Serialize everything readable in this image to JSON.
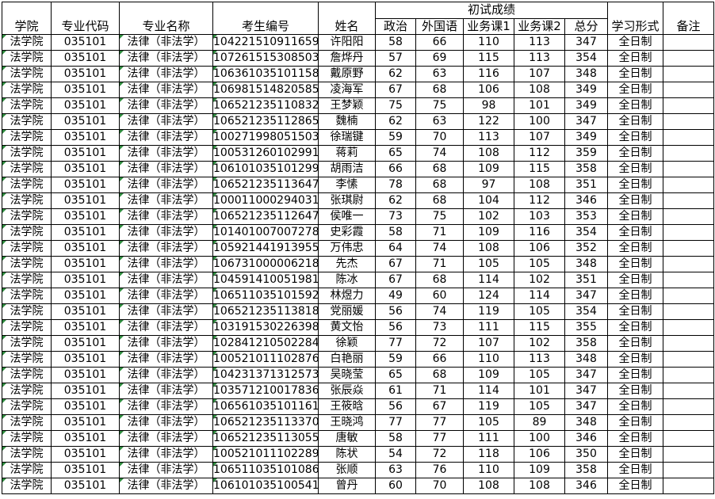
{
  "headers": {
    "college": "学院",
    "major_code": "专业代码",
    "major_name": "专业名称",
    "exam_id": "考生编号",
    "name": "姓名",
    "prelim_group": "初试成绩",
    "politics": "政治",
    "foreign_lang": "外国语",
    "course1": "业务课1",
    "course2": "业务课2",
    "total": "总分",
    "study_mode": "学习形式",
    "remarks": "备注"
  },
  "rows": [
    {
      "college": "法学院",
      "code": "035101",
      "major": "法律（非法学）",
      "exam_id": "104221510911659",
      "name": "许阳阳",
      "politics": "58",
      "foreign": "66",
      "c1": "110",
      "c2": "113",
      "total": "347",
      "mode": "全日制",
      "remark": ""
    },
    {
      "college": "法学院",
      "code": "035101",
      "major": "法律（非法学）",
      "exam_id": "107261515308503",
      "name": "詹烨丹",
      "politics": "57",
      "foreign": "69",
      "c1": "115",
      "c2": "113",
      "total": "354",
      "mode": "全日制",
      "remark": ""
    },
    {
      "college": "法学院",
      "code": "035101",
      "major": "法律（非法学）",
      "exam_id": "106361035101158",
      "name": "戴原野",
      "politics": "62",
      "foreign": "63",
      "c1": "116",
      "c2": "107",
      "total": "348",
      "mode": "全日制",
      "remark": ""
    },
    {
      "college": "法学院",
      "code": "035101",
      "major": "法律（非法学）",
      "exam_id": "106981514820585",
      "name": "凌海军",
      "politics": "67",
      "foreign": "68",
      "c1": "106",
      "c2": "108",
      "total": "349",
      "mode": "全日制",
      "remark": ""
    },
    {
      "college": "法学院",
      "code": "035101",
      "major": "法律（非法学）",
      "exam_id": "106521235110832",
      "name": "王梦颖",
      "politics": "75",
      "foreign": "75",
      "c1": "98",
      "c2": "101",
      "total": "349",
      "mode": "全日制",
      "remark": ""
    },
    {
      "college": "法学院",
      "code": "035101",
      "major": "法律（非法学）",
      "exam_id": "106521235112865",
      "name": "魏楠",
      "politics": "62",
      "foreign": "63",
      "c1": "122",
      "c2": "100",
      "total": "347",
      "mode": "全日制",
      "remark": ""
    },
    {
      "college": "法学院",
      "code": "035101",
      "major": "法律（非法学）",
      "exam_id": "100271998051503",
      "name": "徐瑞键",
      "politics": "59",
      "foreign": "70",
      "c1": "113",
      "c2": "107",
      "total": "349",
      "mode": "全日制",
      "remark": ""
    },
    {
      "college": "法学院",
      "code": "035101",
      "major": "法律（非法学）",
      "exam_id": "100531260102991",
      "name": "蒋莉",
      "politics": "65",
      "foreign": "74",
      "c1": "108",
      "c2": "112",
      "total": "359",
      "mode": "全日制",
      "remark": ""
    },
    {
      "college": "法学院",
      "code": "035101",
      "major": "法律（非法学）",
      "exam_id": "106101035101299",
      "name": "胡雨洁",
      "politics": "66",
      "foreign": "68",
      "c1": "109",
      "c2": "115",
      "total": "358",
      "mode": "全日制",
      "remark": ""
    },
    {
      "college": "法学院",
      "code": "035101",
      "major": "法律（非法学）",
      "exam_id": "106521235113647",
      "name": "李愫",
      "politics": "78",
      "foreign": "68",
      "c1": "97",
      "c2": "108",
      "total": "351",
      "mode": "全日制",
      "remark": ""
    },
    {
      "college": "法学院",
      "code": "035101",
      "major": "法律（非法学）",
      "exam_id": "100011000294031",
      "name": "张琪尉",
      "politics": "62",
      "foreign": "68",
      "c1": "104",
      "c2": "112",
      "total": "346",
      "mode": "全日制",
      "remark": ""
    },
    {
      "college": "法学院",
      "code": "035101",
      "major": "法律（非法学）",
      "exam_id": "106521235112647",
      "name": "侯唯一",
      "politics": "73",
      "foreign": "75",
      "c1": "102",
      "c2": "103",
      "total": "353",
      "mode": "全日制",
      "remark": ""
    },
    {
      "college": "法学院",
      "code": "035101",
      "major": "法律（非法学）",
      "exam_id": "101401007007278",
      "name": "史彩霞",
      "politics": "58",
      "foreign": "71",
      "c1": "109",
      "c2": "116",
      "total": "354",
      "mode": "全日制",
      "remark": ""
    },
    {
      "college": "法学院",
      "code": "035101",
      "major": "法律（非法学）",
      "exam_id": "105921441913955",
      "name": "万伟忠",
      "politics": "64",
      "foreign": "74",
      "c1": "108",
      "c2": "106",
      "total": "352",
      "mode": "全日制",
      "remark": ""
    },
    {
      "college": "法学院",
      "code": "035101",
      "major": "法律（非法学）",
      "exam_id": "106731000006218",
      "name": "先杰",
      "politics": "67",
      "foreign": "71",
      "c1": "105",
      "c2": "105",
      "total": "348",
      "mode": "全日制",
      "remark": ""
    },
    {
      "college": "法学院",
      "code": "035101",
      "major": "法律（非法学）",
      "exam_id": "104591410051981",
      "name": "陈冰",
      "politics": "67",
      "foreign": "68",
      "c1": "114",
      "c2": "102",
      "total": "351",
      "mode": "全日制",
      "remark": ""
    },
    {
      "college": "法学院",
      "code": "035101",
      "major": "法律（非法学）",
      "exam_id": "106511035101592",
      "name": "林煜力",
      "politics": "49",
      "foreign": "60",
      "c1": "124",
      "c2": "114",
      "total": "347",
      "mode": "全日制",
      "remark": ""
    },
    {
      "college": "法学院",
      "code": "035101",
      "major": "法律（非法学）",
      "exam_id": "106521235113818",
      "name": "党丽媛",
      "politics": "56",
      "foreign": "74",
      "c1": "119",
      "c2": "105",
      "total": "354",
      "mode": "全日制",
      "remark": ""
    },
    {
      "college": "法学院",
      "code": "035101",
      "major": "法律（非法学）",
      "exam_id": "103191530226398",
      "name": "黄文怡",
      "politics": "56",
      "foreign": "73",
      "c1": "111",
      "c2": "115",
      "total": "355",
      "mode": "全日制",
      "remark": ""
    },
    {
      "college": "法学院",
      "code": "035101",
      "major": "法律（非法学）",
      "exam_id": "102841210502284",
      "name": "徐颖",
      "politics": "77",
      "foreign": "72",
      "c1": "107",
      "c2": "102",
      "total": "358",
      "mode": "全日制",
      "remark": ""
    },
    {
      "college": "法学院",
      "code": "035101",
      "major": "法律（非法学）",
      "exam_id": "100521011102876",
      "name": "白艳丽",
      "politics": "59",
      "foreign": "66",
      "c1": "110",
      "c2": "113",
      "total": "348",
      "mode": "全日制",
      "remark": ""
    },
    {
      "college": "法学院",
      "code": "035101",
      "major": "法律（非法学）",
      "exam_id": "104231371312573",
      "name": "吴晓莹",
      "politics": "65",
      "foreign": "68",
      "c1": "109",
      "c2": "105",
      "total": "347",
      "mode": "全日制",
      "remark": ""
    },
    {
      "college": "法学院",
      "code": "035101",
      "major": "法律（非法学）",
      "exam_id": "103571210017836",
      "name": "张辰焱",
      "politics": "61",
      "foreign": "71",
      "c1": "114",
      "c2": "101",
      "total": "347",
      "mode": "全日制",
      "remark": ""
    },
    {
      "college": "法学院",
      "code": "035101",
      "major": "法律（非法学）",
      "exam_id": "106561035101161",
      "name": "王筱晗",
      "politics": "56",
      "foreign": "67",
      "c1": "119",
      "c2": "105",
      "total": "347",
      "mode": "全日制",
      "remark": ""
    },
    {
      "college": "法学院",
      "code": "035101",
      "major": "法律（非法学）",
      "exam_id": "106521235113370",
      "name": "王晓鸿",
      "politics": "77",
      "foreign": "77",
      "c1": "105",
      "c2": "89",
      "total": "348",
      "mode": "全日制",
      "remark": ""
    },
    {
      "college": "法学院",
      "code": "035101",
      "major": "法律（非法学）",
      "exam_id": "106521235113055",
      "name": "唐敏",
      "politics": "58",
      "foreign": "77",
      "c1": "111",
      "c2": "100",
      "total": "346",
      "mode": "全日制",
      "remark": ""
    },
    {
      "college": "法学院",
      "code": "035101",
      "major": "法律（非法学）",
      "exam_id": "100521011102289",
      "name": "陈状",
      "politics": "54",
      "foreign": "72",
      "c1": "118",
      "c2": "106",
      "total": "350",
      "mode": "全日制",
      "remark": ""
    },
    {
      "college": "法学院",
      "code": "035101",
      "major": "法律（非法学）",
      "exam_id": "106511035101086",
      "name": "张顺",
      "politics": "63",
      "foreign": "76",
      "c1": "110",
      "c2": "109",
      "total": "358",
      "mode": "全日制",
      "remark": ""
    },
    {
      "college": "法学院",
      "code": "035101",
      "major": "法律（非法学）",
      "exam_id": "106101035100541",
      "name": "曾丹",
      "politics": "60",
      "foreign": "70",
      "c1": "108",
      "c2": "108",
      "total": "346",
      "mode": "全日制",
      "remark": ""
    }
  ],
  "colors": {
    "grid_line": "#000000",
    "cell_marker": "#2e8b3e",
    "background": "#ffffff"
  }
}
